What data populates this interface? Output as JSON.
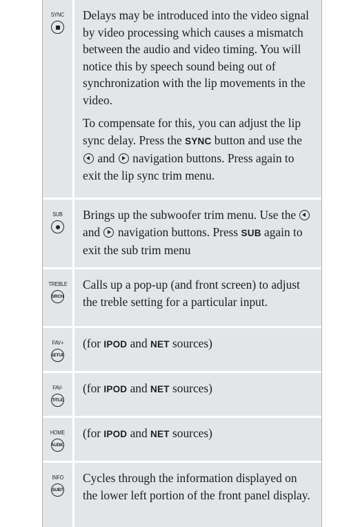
{
  "rows": [
    {
      "button_label": "SYNC",
      "icon": "stop-square-icon",
      "para1": "Delays may be introduced into the video signal by video processing which causes a mismatch between the audio and video timing. You will notice this by speech sound being out of synchronization with the lip movements in the video.",
      "para2_a": "To compensate for this, you can adjust the lip sync delay. Press the ",
      "para2_kw": "SYNC",
      "para2_b": " button and use the ",
      "para2_c": " and ",
      "para2_d": " navigation buttons. Press again to exit the lip sync trim menu."
    },
    {
      "button_label": "SUB",
      "icon": "dot-icon",
      "text_a": "Brings up the subwoofer trim menu. Use the ",
      "text_b": " and ",
      "text_c": " navigation buttons. Press ",
      "text_kw": "SUB",
      "text_d": " again to exit the sub trim menu"
    },
    {
      "button_label": "TREBLE",
      "button_text": "SRCH",
      "text": "Calls up a pop-up (and front screen) to adjust the treble setting for a particular input."
    },
    {
      "button_label": "FAV+",
      "button_text": "SETUP",
      "text_a": "(for ",
      "kw1": "IPOD",
      "text_b": " and ",
      "kw2": "NET",
      "text_c": " sources)"
    },
    {
      "button_label": "FAV-",
      "button_text": "TITLE",
      "text_a": "(for ",
      "kw1": "IPOD",
      "text_b": " and ",
      "kw2": "NET",
      "text_c": " sources)"
    },
    {
      "button_label": "HOME",
      "button_text": "AUDIO",
      "text_a": "(for ",
      "kw1": "IPOD",
      "text_b": " and ",
      "kw2": "NET",
      "text_c": " sources)"
    },
    {
      "button_label": "INFO",
      "button_text": "SUBT",
      "text": "Cycles through the information displayed on the lower left portion of the front panel display."
    }
  ]
}
